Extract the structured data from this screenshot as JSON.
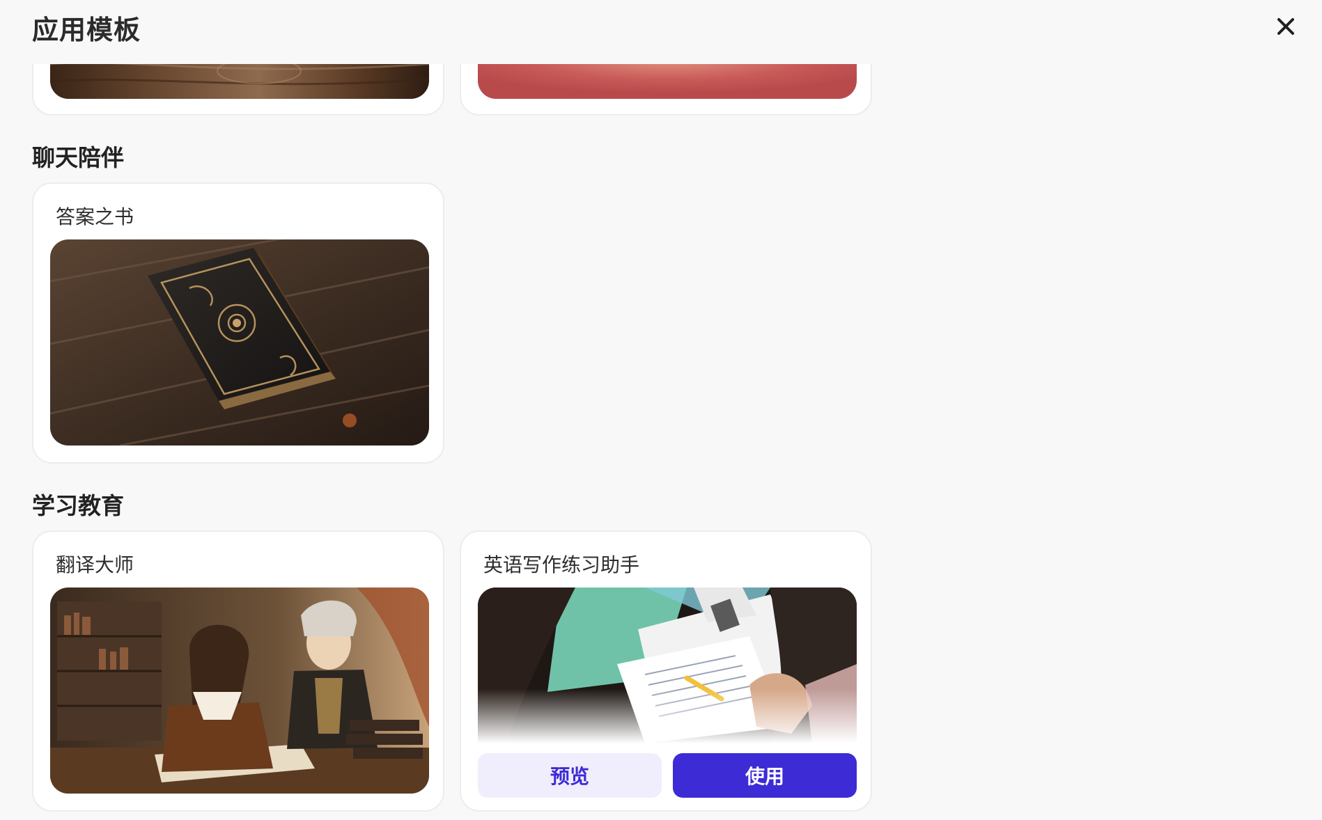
{
  "window": {
    "title": "应用模板"
  },
  "sections": [
    {
      "label": "聊天陪伴",
      "cards": [
        {
          "title": "答案之书"
        }
      ]
    },
    {
      "label": "学习教育",
      "cards": [
        {
          "title": "翻译大师"
        },
        {
          "title": "英语写作练习助手"
        }
      ]
    }
  ],
  "hover_card": {
    "preview_label": "预览",
    "use_label": "使用"
  },
  "colors": {
    "accent": "#3d2bd6",
    "accent_light": "#f0eefc",
    "background": "#f8f8f9"
  }
}
